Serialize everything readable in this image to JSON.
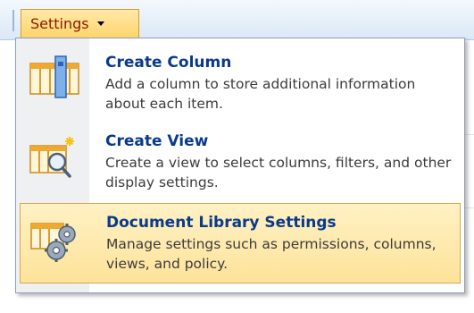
{
  "toolbar": {
    "settings_label": "Settings"
  },
  "menu": {
    "items": [
      {
        "title": "Create Column",
        "description": "Add a column to store additional information about each item.",
        "icon": "create-column-icon"
      },
      {
        "title": "Create View",
        "description": "Create a view to select columns, filters, and other display settings.",
        "icon": "create-view-icon"
      },
      {
        "title": "Document Library Settings",
        "description": "Manage settings such as permissions, columns, views, and policy.",
        "icon": "library-settings-icon",
        "selected": true
      }
    ]
  },
  "colors": {
    "accent_title": "#0a3a8a",
    "highlight": "#fde39a",
    "settings_text": "#8a1a00"
  }
}
